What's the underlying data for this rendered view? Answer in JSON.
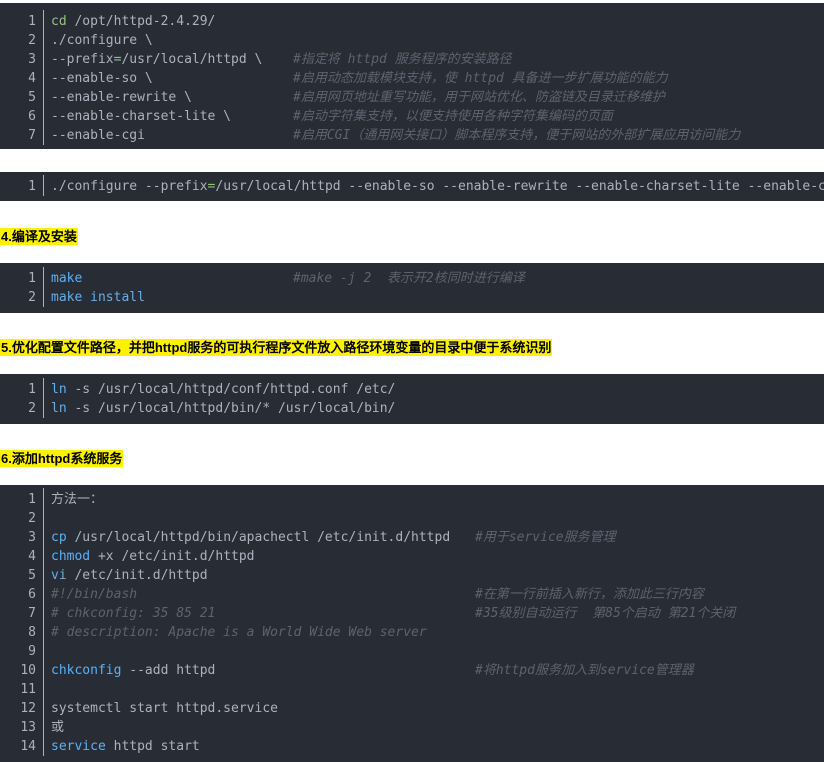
{
  "block1": {
    "lines": [
      {
        "num": "1",
        "parts": [
          {
            "t": "cd",
            "c": "k-green"
          },
          {
            "t": " /opt/httpd-2.4.29/"
          }
        ],
        "comment": ""
      },
      {
        "num": "2",
        "parts": [
          {
            "t": "./configure \\"
          }
        ],
        "comment": ""
      },
      {
        "num": "3",
        "parts": [
          {
            "t": "--prefix"
          },
          {
            "t": "=",
            "c": "op"
          },
          {
            "t": "/usr/local/httpd \\"
          }
        ],
        "comment": "#指定将 httpd 服务程序的安装路径"
      },
      {
        "num": "4",
        "parts": [
          {
            "t": "--enable-so \\"
          }
        ],
        "comment": "#启用动态加载模块支持，使 httpd 具备进一步扩展功能的能力"
      },
      {
        "num": "5",
        "parts": [
          {
            "t": "--enable-rewrite \\"
          }
        ],
        "comment": "#启用网页地址重写功能，用于网站优化、防盗链及目录迁移维护"
      },
      {
        "num": "6",
        "parts": [
          {
            "t": "--enable-charset-lite \\"
          }
        ],
        "comment": "#启动字符集支持，以便支持使用各种字符集编码的页面"
      },
      {
        "num": "7",
        "parts": [
          {
            "t": "--enable-cgi"
          }
        ],
        "comment": "#启用CGI（通用网关接口）脚本程序支持，便于网站的外部扩展应用访问能力"
      }
    ]
  },
  "block2": {
    "lines": [
      {
        "num": "1",
        "parts": [
          {
            "t": "./configure --prefix"
          },
          {
            "t": "=",
            "c": "op"
          },
          {
            "t": "/usr/local/httpd --enable-so --enable-rewrite --enable-charset-lite --enable-cgi"
          }
        ],
        "comment": ""
      }
    ]
  },
  "heading4": "4.编译及安装",
  "block3": {
    "lines": [
      {
        "num": "1",
        "parts": [
          {
            "t": "make",
            "c": "k-blue"
          }
        ],
        "comment": "#make -j 2  表示开2核同时进行编译"
      },
      {
        "num": "2",
        "parts": [
          {
            "t": "make install",
            "c": "k-blue"
          }
        ],
        "comment": ""
      }
    ]
  },
  "heading5": "5.优化配置文件路径，并把httpd服务的可执行程序文件放入路径环境变量的目录中便于系统识别",
  "block4": {
    "lines": [
      {
        "num": "1",
        "parts": [
          {
            "t": "ln",
            "c": "k-blue"
          },
          {
            "t": " -s /usr/local/httpd/conf/httpd.conf /etc/"
          }
        ],
        "comment": ""
      },
      {
        "num": "2",
        "parts": [
          {
            "t": "ln",
            "c": "k-blue"
          },
          {
            "t": " -s /usr/local/httpd/bin/* /usr/local/bin/"
          }
        ],
        "comment": ""
      }
    ]
  },
  "heading6": "6.添加httpd系统服务",
  "block5": {
    "lines": [
      {
        "num": "1",
        "parts": [
          {
            "t": "方法一："
          }
        ],
        "comment": ""
      },
      {
        "num": "2",
        "parts": [],
        "comment": ""
      },
      {
        "num": "3",
        "parts": [
          {
            "t": "cp",
            "c": "k-blue"
          },
          {
            "t": " /usr/local/httpd/bin/apachectl /etc/init.d/httpd"
          }
        ],
        "comment": "#用于service服务管理"
      },
      {
        "num": "4",
        "parts": [
          {
            "t": "chmod",
            "c": "k-blue"
          },
          {
            "t": " +x /etc/init.d/httpd"
          }
        ],
        "comment": ""
      },
      {
        "num": "5",
        "parts": [
          {
            "t": "vi",
            "c": "k-blue"
          },
          {
            "t": " /etc/init.d/httpd"
          }
        ],
        "comment": ""
      },
      {
        "num": "6",
        "parts": [
          {
            "t": "#!/bin/bash",
            "c": "cmtinline"
          }
        ],
        "comment": "#在第一行前插入新行，添加此三行内容"
      },
      {
        "num": "7",
        "parts": [
          {
            "t": "# chkconfig: 35 85 21",
            "c": "cmtinline"
          }
        ],
        "comment": "#35级别自动运行  第85个启动 第21个关闭"
      },
      {
        "num": "8",
        "parts": [
          {
            "t": "# description: Apache is a World Wide Web server",
            "c": "cmtinline"
          }
        ],
        "comment": ""
      },
      {
        "num": "9",
        "parts": [],
        "comment": ""
      },
      {
        "num": "10",
        "parts": [
          {
            "t": "chkconfig",
            "c": "k-blue"
          },
          {
            "t": " --add httpd"
          }
        ],
        "comment": "#将httpd服务加入到service管理器"
      },
      {
        "num": "11",
        "parts": [],
        "comment": ""
      },
      {
        "num": "12",
        "parts": [
          {
            "t": "systemctl start httpd.service"
          }
        ],
        "comment": ""
      },
      {
        "num": "13",
        "parts": [
          {
            "t": "或"
          }
        ],
        "comment": ""
      },
      {
        "num": "14",
        "parts": [
          {
            "t": "service",
            "c": "k-blue"
          },
          {
            "t": " httpd start"
          }
        ],
        "comment": ""
      }
    ]
  },
  "colors": {
    "code_bg": "#282c34",
    "code_text": "#abb2bf",
    "comment": "#5c6370",
    "keyword": "#61afef",
    "cd_green": "#98c379",
    "heading_highlight": "#fff200"
  }
}
